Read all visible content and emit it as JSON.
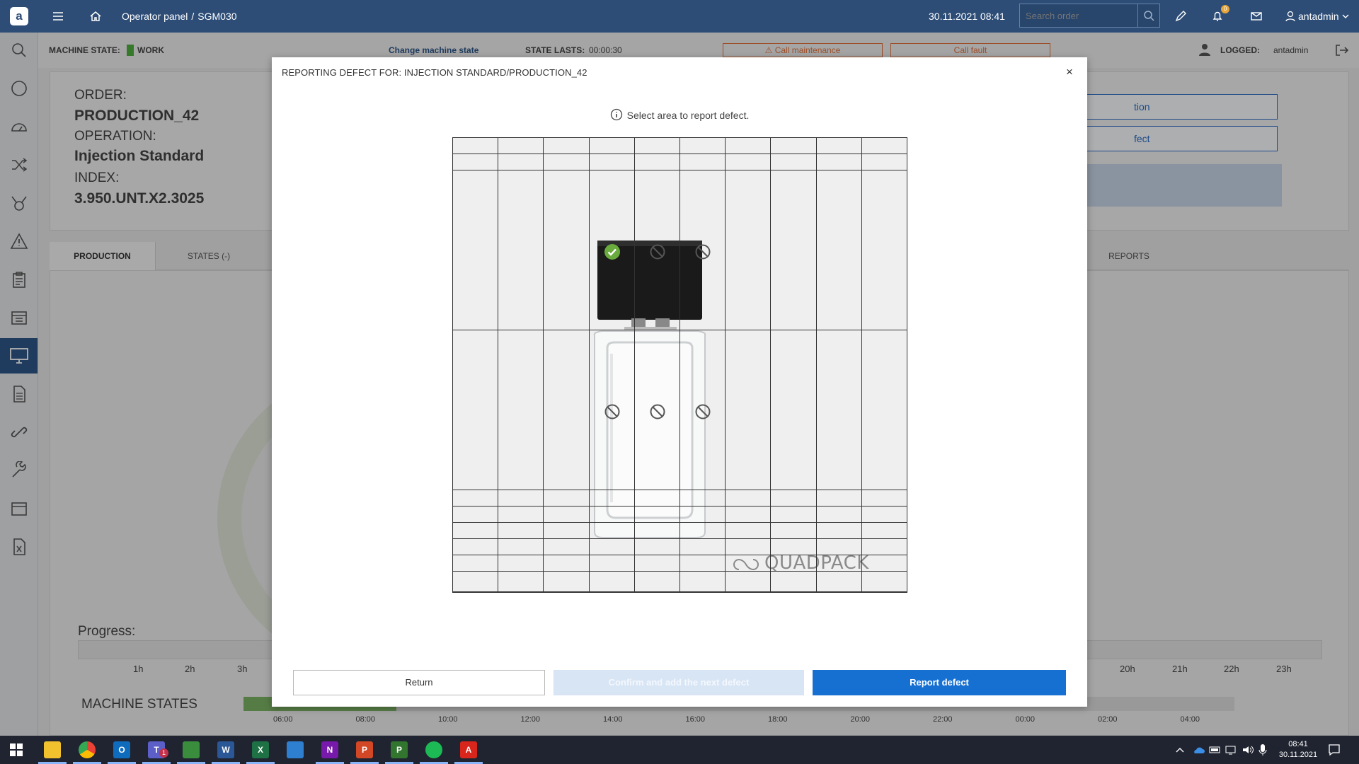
{
  "topbar": {
    "logo": "a",
    "breadcrumb_root": "Operator panel",
    "breadcrumb_sep": "/",
    "breadcrumb_current": "SGM030",
    "datetime": "30.11.2021 08:41",
    "search_placeholder": "Search order",
    "notification_count": "0",
    "username": "antadmin",
    "icons": [
      "menu-icon",
      "home-icon",
      "search-icon",
      "pencil-icon",
      "bell-icon",
      "mail-icon",
      "user-icon",
      "chevron-down-icon"
    ]
  },
  "sidebar": {
    "icons": [
      "search-icon",
      "circle-icon",
      "dashboard-icon",
      "shuffle-icon",
      "medal-icon",
      "warning-icon",
      "clipboard-icon",
      "calendar-icon",
      "monitor-icon",
      "document-icon",
      "link-icon",
      "wrench-icon",
      "window-icon",
      "excel-icon"
    ],
    "active_index": 8
  },
  "statebar": {
    "machine_state_label": "MACHINE STATE:",
    "machine_state_value": "WORK",
    "change_state_link": "Change machine state",
    "state_lasts_label": "STATE LASTS:",
    "state_lasts_value": "00:00:30",
    "call_maintenance": "Call maintenance",
    "call_fault": "Call fault",
    "logged_label": "LOGGED:",
    "logged_user": "antadmin",
    "accent_color": "#e0703a",
    "work_color": "#4fae3e"
  },
  "order": {
    "order_label": "ORDER:",
    "order_value": "PRODUCTION_42",
    "operation_label": "OPERATION:",
    "operation_value": "Injection Standard",
    "index_label": "INDEX:",
    "index_value": "3.950.UNT.X2.3025",
    "btn1_partial": "tion",
    "btn2_partial": "fect"
  },
  "tabs": {
    "production": "PRODUCTION",
    "states": "STATES (-)",
    "reports_partial": "REPORTS"
  },
  "progress": {
    "label": "Progress:",
    "hours_left": [
      "1h",
      "2h",
      "3h"
    ],
    "hours_right": [
      "20h",
      "21h",
      "22h",
      "23h"
    ]
  },
  "machine_states": {
    "label": "MACHINE STATES",
    "ticks": [
      "06:00",
      "08:00",
      "10:00",
      "12:00",
      "14:00",
      "16:00",
      "18:00",
      "20:00",
      "22:00",
      "00:00",
      "02:00",
      "04:00"
    ],
    "work_fraction": 0.154
  },
  "modal": {
    "title": "REPORTING DEFECT FOR: INJECTION STANDARD/PRODUCTION_42",
    "close": "×",
    "info_text": "Select area to report defect.",
    "brand_text": "QUADPACK",
    "grid": {
      "columns": 10,
      "selected_cells": [
        {
          "row": 2,
          "col": 3
        }
      ],
      "blocked_cells": [
        {
          "row": 2,
          "col": 4
        },
        {
          "row": 2,
          "col": 5
        },
        {
          "row": 3,
          "col": 3
        },
        {
          "row": 3,
          "col": 4
        },
        {
          "row": 3,
          "col": 5
        }
      ]
    },
    "buttons": {
      "return": "Return",
      "confirm_next": "Confirm and add the next defect",
      "report": "Report defect"
    },
    "selected_color": "#6aab3d",
    "report_color": "#1670d2"
  },
  "taskbar": {
    "apps": [
      "file-explorer-icon",
      "chrome-icon",
      "outlook-icon",
      "teams-icon",
      "notepad-icon",
      "word-icon",
      "excel-icon",
      "edge-icon",
      "onenote-icon",
      "powerpoint-icon",
      "project-icon",
      "spotify-icon",
      "acrobat-icon"
    ],
    "app_letters": [
      "",
      "",
      "O",
      "T",
      "",
      "W",
      "X",
      "",
      "N",
      "P",
      "P",
      "",
      "A"
    ],
    "teams_badge": "1",
    "time": "08:41",
    "date": "30.11.2021"
  }
}
